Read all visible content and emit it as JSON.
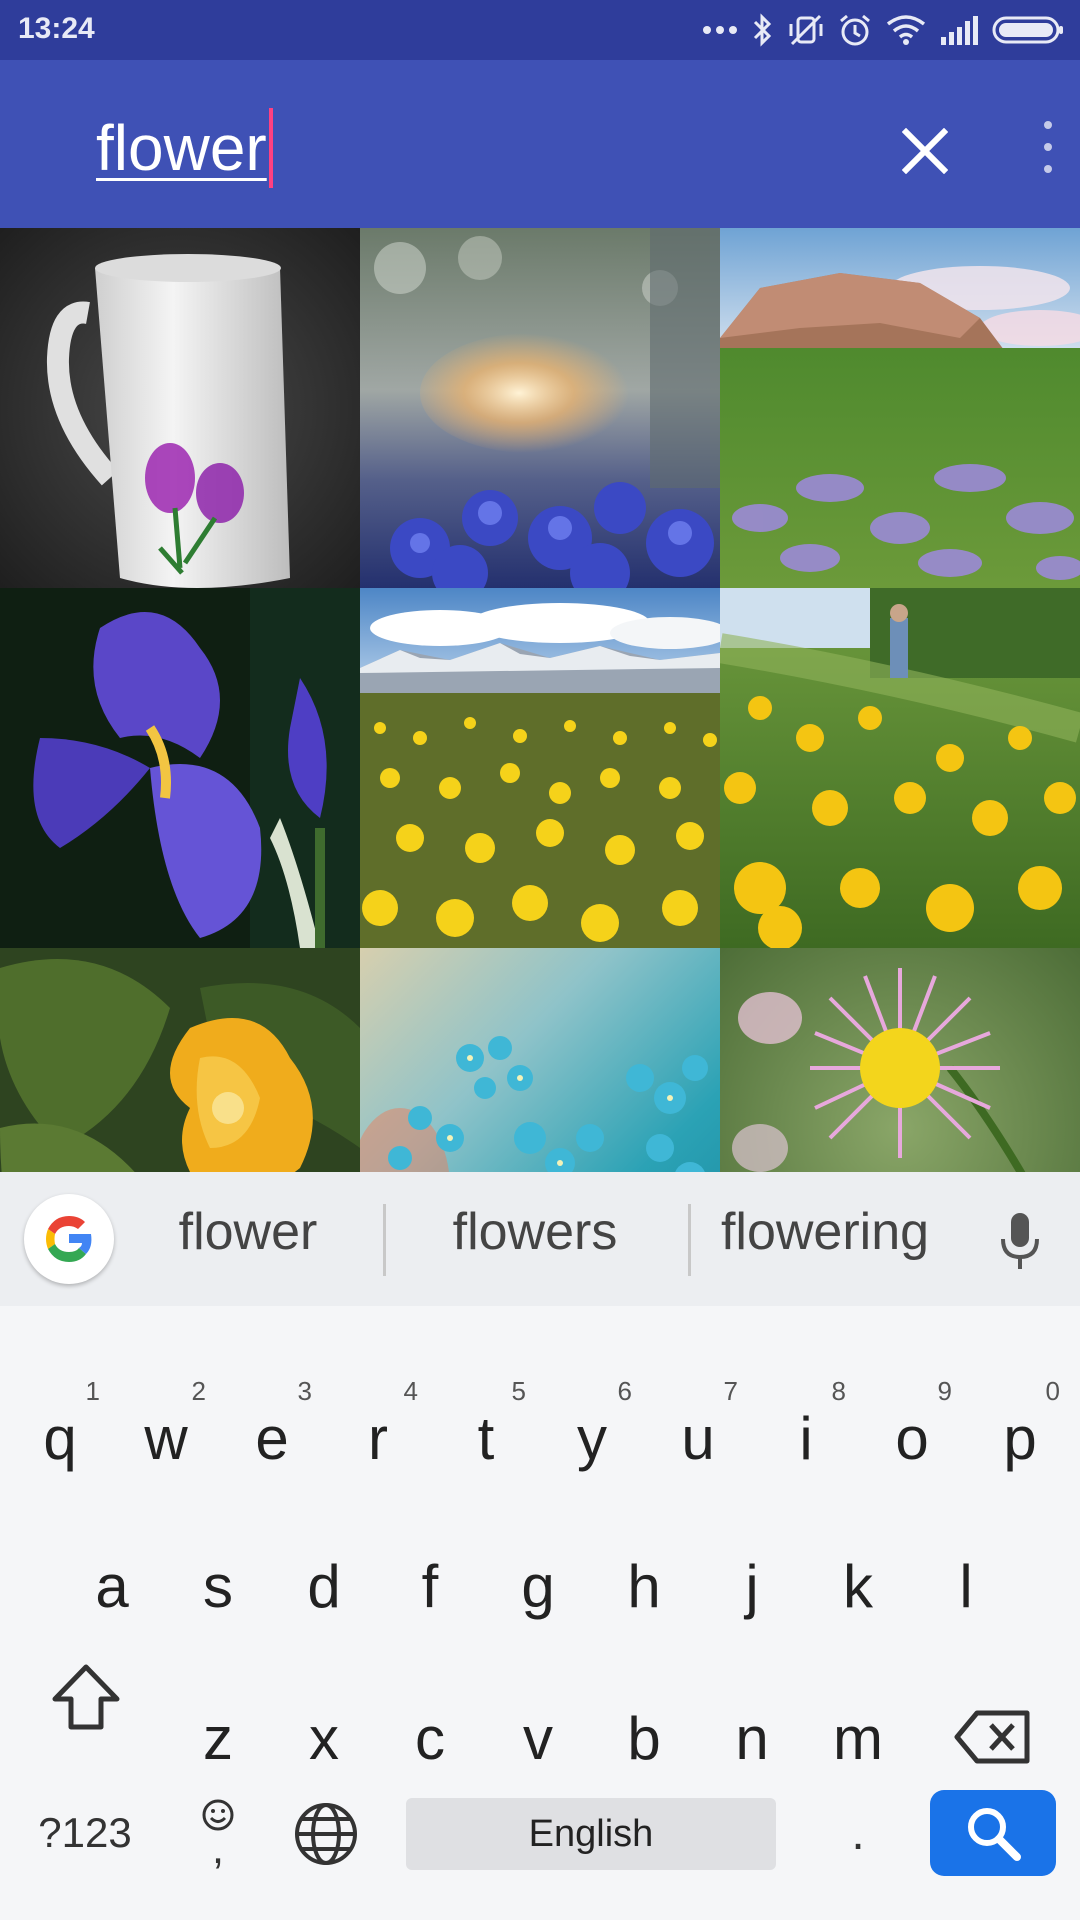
{
  "status_bar": {
    "time": "13:24"
  },
  "search": {
    "query": "flower"
  },
  "results": {
    "tiles": [
      {
        "name": "mug-with-purple-flowers"
      },
      {
        "name": "blue-flowers-bokeh"
      },
      {
        "name": "mountain-meadow-lupines"
      },
      {
        "name": "purple-iris"
      },
      {
        "name": "dandelion-field-mountains"
      },
      {
        "name": "yellow-buttercups-path"
      },
      {
        "name": "yellow-squash-flower"
      },
      {
        "name": "turquoise-forget-me-nots"
      },
      {
        "name": "pink-daisy-fleabane"
      }
    ]
  },
  "keyboard": {
    "suggestions": [
      "flower",
      "flowers",
      "flowering"
    ],
    "row1": [
      {
        "label": "q",
        "hint": "1"
      },
      {
        "label": "w",
        "hint": "2"
      },
      {
        "label": "e",
        "hint": "3"
      },
      {
        "label": "r",
        "hint": "4"
      },
      {
        "label": "t",
        "hint": "5"
      },
      {
        "label": "y",
        "hint": "6"
      },
      {
        "label": "u",
        "hint": "7"
      },
      {
        "label": "i",
        "hint": "8"
      },
      {
        "label": "o",
        "hint": "9"
      },
      {
        "label": "p",
        "hint": "0"
      }
    ],
    "row2": [
      "a",
      "s",
      "d",
      "f",
      "g",
      "h",
      "j",
      "k",
      "l"
    ],
    "row3": [
      "z",
      "x",
      "c",
      "v",
      "b",
      "n",
      "m"
    ],
    "symbols_label": "?123",
    "comma_label": ",",
    "space_label": "English",
    "period_label": ".",
    "accent_color": "#1a73e8"
  },
  "colors": {
    "status_bar": "#2f3d9b",
    "app_bar": "#3f51b5",
    "caret": "#ff4081"
  }
}
